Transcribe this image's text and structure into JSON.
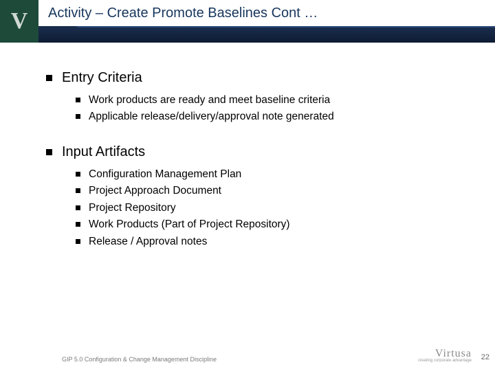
{
  "header": {
    "title": "Activity – Create Promote Baselines Cont …",
    "logo_letter": "V"
  },
  "sections": [
    {
      "heading": "Entry Criteria",
      "items": [
        "Work products are ready and meet baseline criteria",
        "Applicable release/delivery/approval note generated"
      ]
    },
    {
      "heading": "Input Artifacts",
      "items": [
        "Configuration Management Plan",
        "Project Approach Document",
        "Project Repository",
        "Work Products (Part of Project Repository)",
        "Release / Approval notes"
      ]
    }
  ],
  "footer": {
    "text": "GIP 5.0 Configuration & Change Management Discipline",
    "brand": "Virtusa",
    "tagline": "creating corporate advantage",
    "page": "22"
  }
}
